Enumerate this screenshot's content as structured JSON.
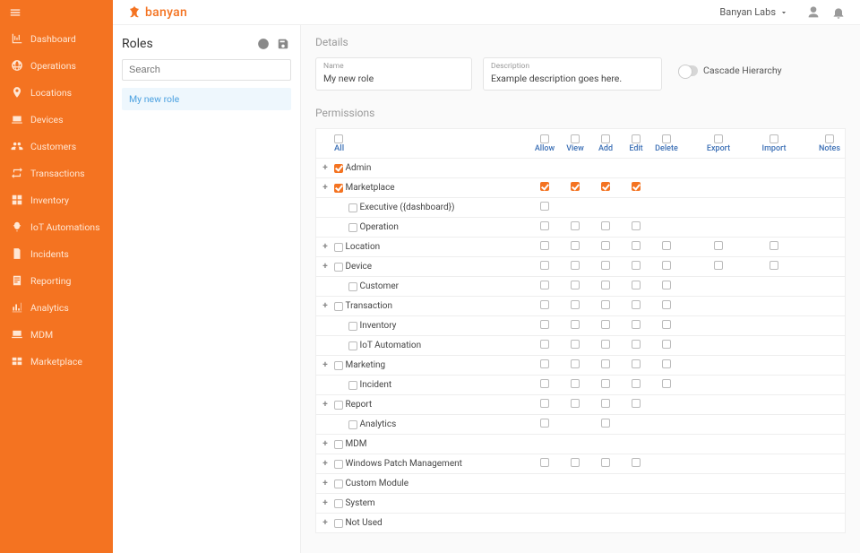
{
  "brand": {
    "name": "banyan"
  },
  "topbar": {
    "org_label": "Banyan Labs"
  },
  "sidebar": {
    "items": [
      {
        "label": "Dashboard",
        "icon": "chart"
      },
      {
        "label": "Operations",
        "icon": "globe"
      },
      {
        "label": "Locations",
        "icon": "pin"
      },
      {
        "label": "Devices",
        "icon": "devices"
      },
      {
        "label": "Customers",
        "icon": "users"
      },
      {
        "label": "Transactions",
        "icon": "swap"
      },
      {
        "label": "Inventory",
        "icon": "grid"
      },
      {
        "label": "IoT Automations",
        "icon": "iot"
      },
      {
        "label": "Incidents",
        "icon": "doc"
      },
      {
        "label": "Reporting",
        "icon": "report"
      },
      {
        "label": "Analytics",
        "icon": "analytics"
      },
      {
        "label": "MDM",
        "icon": "laptop"
      },
      {
        "label": "Marketplace",
        "icon": "cards"
      }
    ]
  },
  "roles_panel": {
    "title": "Roles",
    "search_placeholder": "Search",
    "items": [
      {
        "label": "My new role"
      }
    ]
  },
  "details": {
    "section_label": "Details",
    "name_label": "Name",
    "name_value": "My new role",
    "desc_label": "Description",
    "desc_value": "Example description goes here.",
    "cascade_label": "Cascade Hierarchy"
  },
  "permissions": {
    "section_label": "Permissions",
    "cols": {
      "all": "All",
      "allow": "Allow",
      "view": "View",
      "add": "Add",
      "edit": "Edit",
      "delete": "Delete",
      "export": "Export",
      "import": "Import",
      "notes": "Notes"
    },
    "rows": [
      {
        "name": "Admin",
        "expand": true,
        "all": "on",
        "perms": [
          null,
          null,
          null,
          null,
          null,
          null,
          null,
          null
        ]
      },
      {
        "name": "Marketplace",
        "expand": true,
        "all": "on",
        "perms": [
          "on",
          "on",
          "on",
          "on",
          null,
          null,
          null,
          null
        ]
      },
      {
        "name": "Executive ({dashboard})",
        "child": true,
        "all": "off",
        "perms": [
          "off",
          null,
          null,
          null,
          null,
          null,
          null,
          null
        ]
      },
      {
        "name": "Operation",
        "child": true,
        "all": "off",
        "perms": [
          "off",
          "off",
          "off",
          "off",
          null,
          null,
          null,
          null
        ]
      },
      {
        "name": "Location",
        "expand": true,
        "all": "off",
        "perms": [
          "off",
          "off",
          "off",
          "off",
          "off",
          "off",
          "off",
          null
        ]
      },
      {
        "name": "Device",
        "expand": true,
        "all": "off",
        "perms": [
          "off",
          "off",
          "off",
          "off",
          "off",
          "off",
          "off",
          null
        ]
      },
      {
        "name": "Customer",
        "child": true,
        "all": "off",
        "perms": [
          "off",
          "off",
          "off",
          "off",
          "off",
          null,
          null,
          null
        ]
      },
      {
        "name": "Transaction",
        "expand": true,
        "all": "off",
        "perms": [
          "off",
          "off",
          "off",
          "off",
          "off",
          null,
          null,
          null
        ]
      },
      {
        "name": "Inventory",
        "child": true,
        "all": "off",
        "perms": [
          "off",
          "off",
          "off",
          "off",
          "off",
          null,
          null,
          null
        ]
      },
      {
        "name": "IoT Automation",
        "child": true,
        "all": "off",
        "perms": [
          "off",
          "off",
          "off",
          "off",
          "off",
          null,
          null,
          null
        ]
      },
      {
        "name": "Marketing",
        "expand": true,
        "all": "off",
        "perms": [
          "off",
          "off",
          "off",
          "off",
          "off",
          null,
          null,
          null
        ]
      },
      {
        "name": "Incident",
        "child": true,
        "all": "off",
        "perms": [
          "off",
          "off",
          "off",
          "off",
          "off",
          null,
          null,
          null
        ]
      },
      {
        "name": "Report",
        "expand": true,
        "all": "off",
        "perms": [
          "off",
          "off",
          "off",
          "off",
          null,
          null,
          null,
          null
        ]
      },
      {
        "name": "Analytics",
        "child": true,
        "all": "off",
        "perms": [
          "off",
          null,
          "off",
          null,
          null,
          null,
          null,
          null
        ]
      },
      {
        "name": "MDM",
        "expand": true,
        "all": "off",
        "perms": [
          null,
          null,
          null,
          null,
          null,
          null,
          null,
          null
        ]
      },
      {
        "name": "Windows Patch Management",
        "expand": true,
        "all": "off",
        "perms": [
          "off",
          "off",
          "off",
          "off",
          null,
          null,
          null,
          null
        ]
      },
      {
        "name": "Custom Module",
        "expand": true,
        "all": "off",
        "perms": [
          null,
          null,
          null,
          null,
          null,
          null,
          null,
          null
        ]
      },
      {
        "name": "System",
        "expand": true,
        "all": "off",
        "perms": [
          null,
          null,
          null,
          null,
          null,
          null,
          null,
          null
        ]
      },
      {
        "name": "Not Used",
        "expand": true,
        "all": "off",
        "perms": [
          null,
          null,
          null,
          null,
          null,
          null,
          null,
          null
        ]
      }
    ]
  }
}
